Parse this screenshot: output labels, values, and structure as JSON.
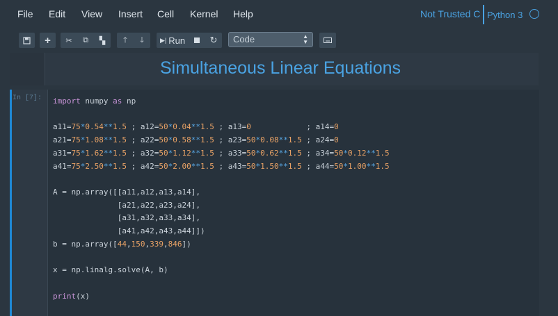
{
  "menubar": {
    "items": [
      "File",
      "Edit",
      "View",
      "Insert",
      "Cell",
      "Kernel",
      "Help"
    ],
    "trust": "Not Trusted C",
    "kernel": "Python 3"
  },
  "toolbar": {
    "run_label": "Run",
    "cell_type": "Code",
    "icons": [
      "save-icon",
      "add-icon",
      "cut-icon",
      "copy-icon",
      "paste-icon",
      "move-up-icon",
      "move-down-icon",
      "run-icon",
      "stop-icon",
      "restart-icon",
      "keyboard-icon"
    ]
  },
  "notebook": {
    "title": "Simultaneous Linear Equations",
    "cell_prompt": "In [7]:",
    "code_lines": [
      "import numpy as np",
      "",
      "a11=75*0.54**1.5 ; a12=50*0.04**1.5 ; a13=0            ; a14=0",
      "a21=75*1.08**1.5 ; a22=50*0.58**1.5 ; a23=50*0.08**1.5 ; a24=0",
      "a31=75*1.62**1.5 ; a32=50*1.12**1.5 ; a33=50*0.62**1.5 ; a34=50*0.12**1.5",
      "a41=75*2.50**1.5 ; a42=50*2.00**1.5 ; a43=50*1.50**1.5 ; a44=50*1.00**1.5",
      "",
      "A = np.array([[a11,a12,a13,a14],",
      "              [a21,a22,a23,a24],",
      "              [a31,a32,a33,a34],",
      "              [a41,a42,a43,a44]])",
      "b = np.array([44,150,339,846])",
      "",
      "x = np.linalg.solve(A, b)",
      "",
      "print(x)"
    ]
  },
  "colors": {
    "accent": "#4aa3e3",
    "keyword": "#c994d8",
    "number": "#e8a266",
    "operator": "#5aa9e6",
    "background": "#2b3640"
  }
}
